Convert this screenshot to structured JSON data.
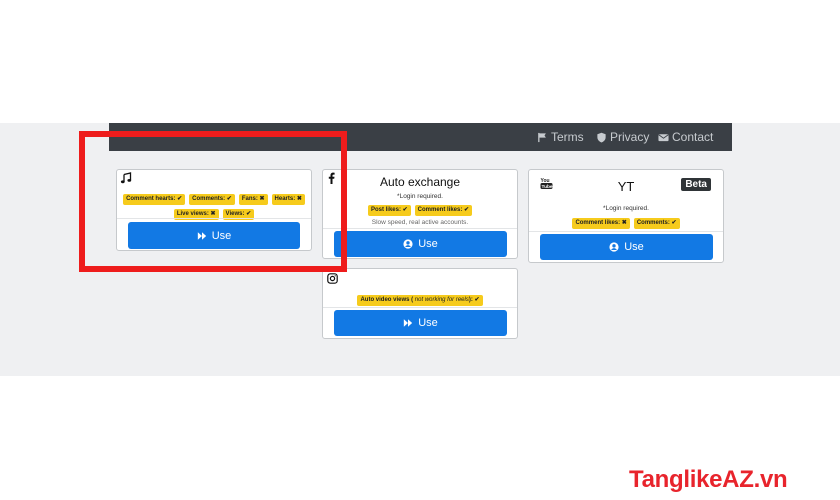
{
  "nav": {
    "links": [
      "Terms",
      "Privacy",
      "Contact"
    ],
    "icons": [
      "flag-icon",
      "shield-icon",
      "envelope-icon"
    ]
  },
  "cards": {
    "tiktok": {
      "icon": "music-note-icon",
      "badges": [
        "Comment hearts:",
        "Comments:",
        "Fans:",
        "Hearts:",
        "Live views:",
        "Views:"
      ],
      "button": "Use"
    },
    "facebook": {
      "icon": "facebook-icon",
      "title": "Auto exchange",
      "note": "*Login required.",
      "badges": [
        "Post likes:",
        "Comment likes:"
      ],
      "note2": "Slow speed, real active accounts.",
      "button": "Use"
    },
    "youtube": {
      "icon": "youtube-icon",
      "title": "YT",
      "beta": "Beta",
      "note": "*Login required.",
      "badges": [
        "Comment likes:",
        "Comments:"
      ],
      "button": "Use"
    },
    "instagram": {
      "icon": "instagram-icon",
      "badge_main": "Auto video views (",
      "badge_em": " not working for reels",
      "badge_end": "):",
      "button": "Use"
    }
  },
  "watermark": "TanglikeAZ.vn",
  "colors": {
    "accent": "#1279e4",
    "badge": "#f6cb1c",
    "navbar": "#3a3f45",
    "highlight": "#ee1c1c",
    "watermark": "#e8242c"
  }
}
